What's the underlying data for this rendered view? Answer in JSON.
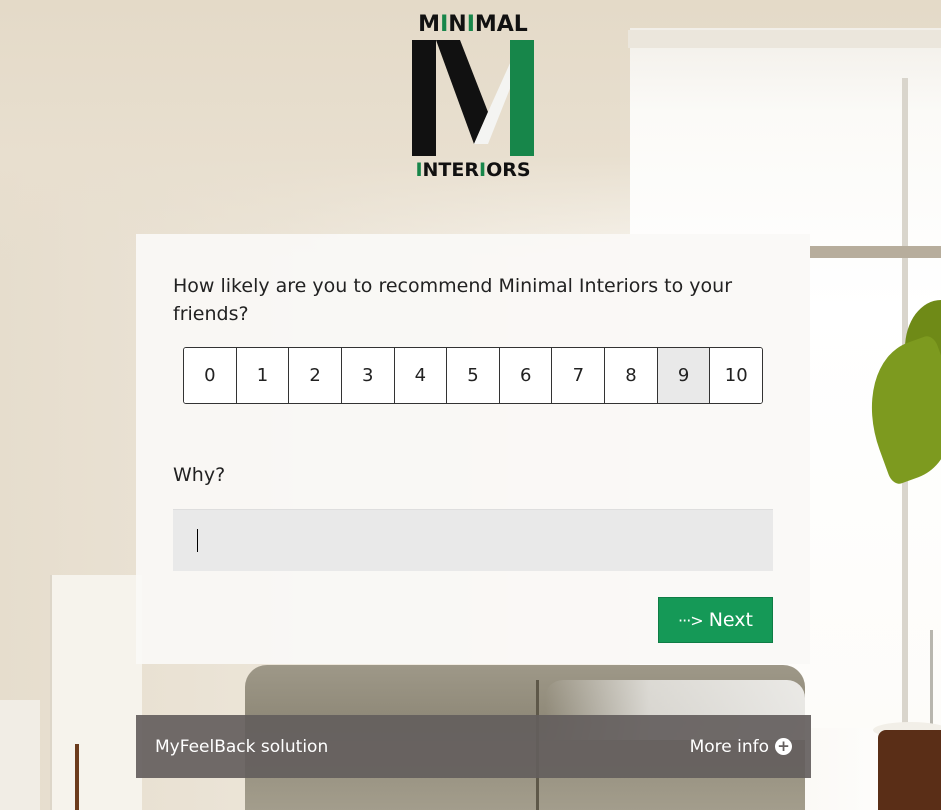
{
  "brand": {
    "logo_top": [
      "M",
      "I",
      "N",
      "I",
      "MAL"
    ],
    "logo_top_text": "MINIMAL",
    "logo_bottom_text": "INTERIORS",
    "colors": {
      "black": "#111111",
      "green": "#17864a",
      "white": "#f4f4f2"
    }
  },
  "survey": {
    "question": "How likely are you to recommend Minimal Interiors to your friends?",
    "scale": {
      "options": [
        "0",
        "1",
        "2",
        "3",
        "4",
        "5",
        "6",
        "7",
        "8",
        "9",
        "10"
      ],
      "selected": "9"
    },
    "why_label": "Why?",
    "why_value": "",
    "next_label": "Next",
    "next_icon": "dotted-arrow-right-icon",
    "accent_color": "#159957"
  },
  "footer": {
    "left_text": "MyFeelBack solution",
    "right_text": "More info",
    "right_icon": "plus-circle-icon"
  }
}
